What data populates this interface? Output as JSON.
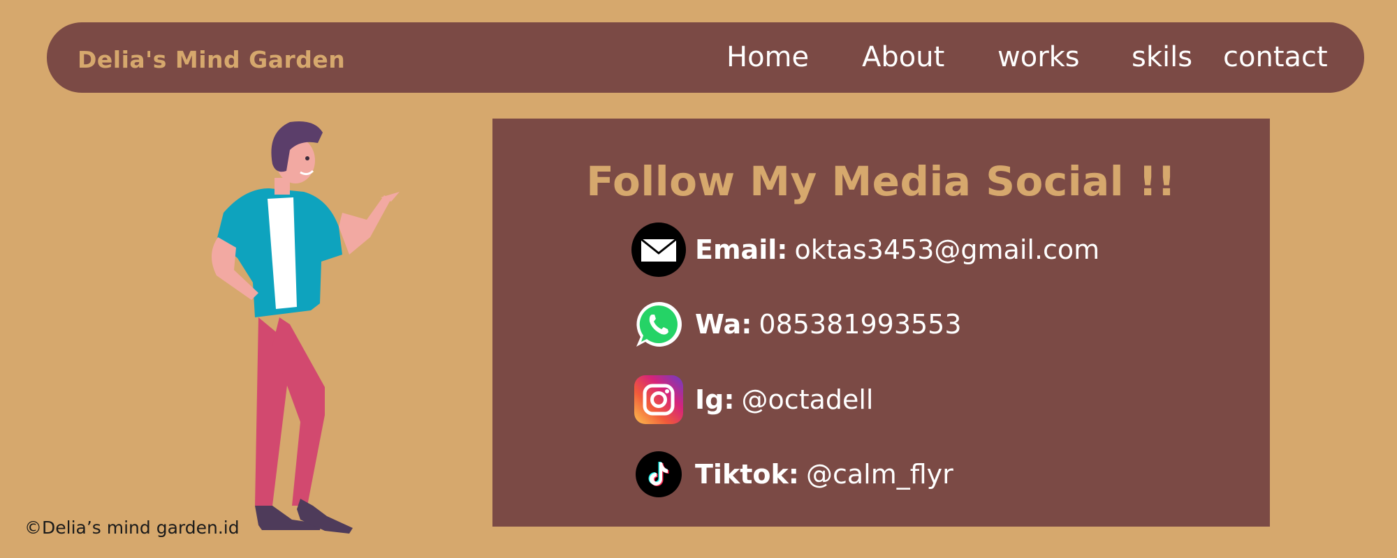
{
  "header": {
    "brand": "Delia's Mind Garden",
    "nav": [
      "Home",
      "About",
      "works",
      "skils",
      "contact"
    ]
  },
  "main": {
    "title": "Follow My Media Social !!",
    "contacts": [
      {
        "label": "Email:",
        "value": "oktas3453@gmail.com",
        "icon": "email-icon"
      },
      {
        "label": "Wa:",
        "value": "085381993553",
        "icon": "whatsapp-icon"
      },
      {
        "label": "Ig:",
        "value": "@octadell",
        "icon": "instagram-icon"
      },
      {
        "label": "Tiktok:",
        "value": "@calm_flyr",
        "icon": "tiktok-icon"
      }
    ]
  },
  "footer": {
    "copyright": "©Delia’s mind garden.id"
  },
  "colors": {
    "background": "#D6A86D",
    "panel": "#7B4A45",
    "accent_text": "#D6A86D",
    "body_text": "#FFFFFF"
  }
}
